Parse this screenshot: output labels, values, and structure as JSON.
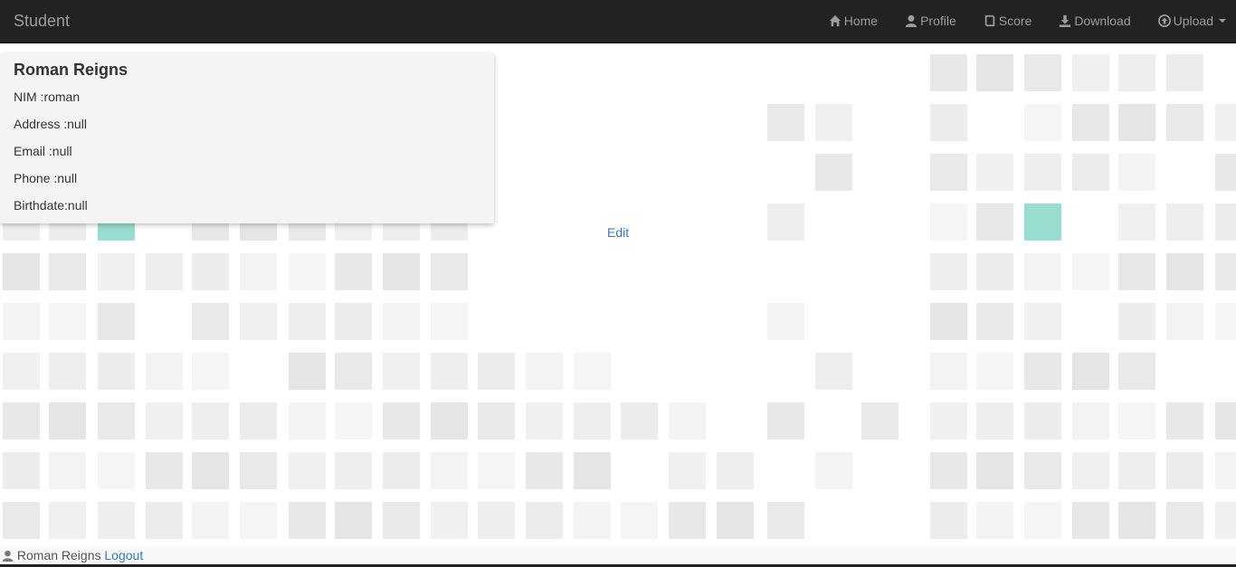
{
  "navbar": {
    "brand": "Student",
    "items": [
      {
        "label": "Home",
        "icon": "home-icon"
      },
      {
        "label": "Profile",
        "icon": "user-icon"
      },
      {
        "label": "Score",
        "icon": "book-icon"
      },
      {
        "label": "Download",
        "icon": "download-icon"
      },
      {
        "label": "Upload",
        "icon": "upload-icon"
      }
    ]
  },
  "profile": {
    "name": "Roman Reigns",
    "nim": "NIM :roman",
    "address": "Address :null",
    "email": "Email :null",
    "phone": "Phone :null",
    "birthdate": "Birthdate:null"
  },
  "edit_label": "Edit",
  "footer": {
    "user": "Roman Reigns",
    "logout": "Logout"
  },
  "colors": {
    "navbar_bg": "#222222",
    "accent_tile": "#98ddd0",
    "link": "#337ab7"
  }
}
